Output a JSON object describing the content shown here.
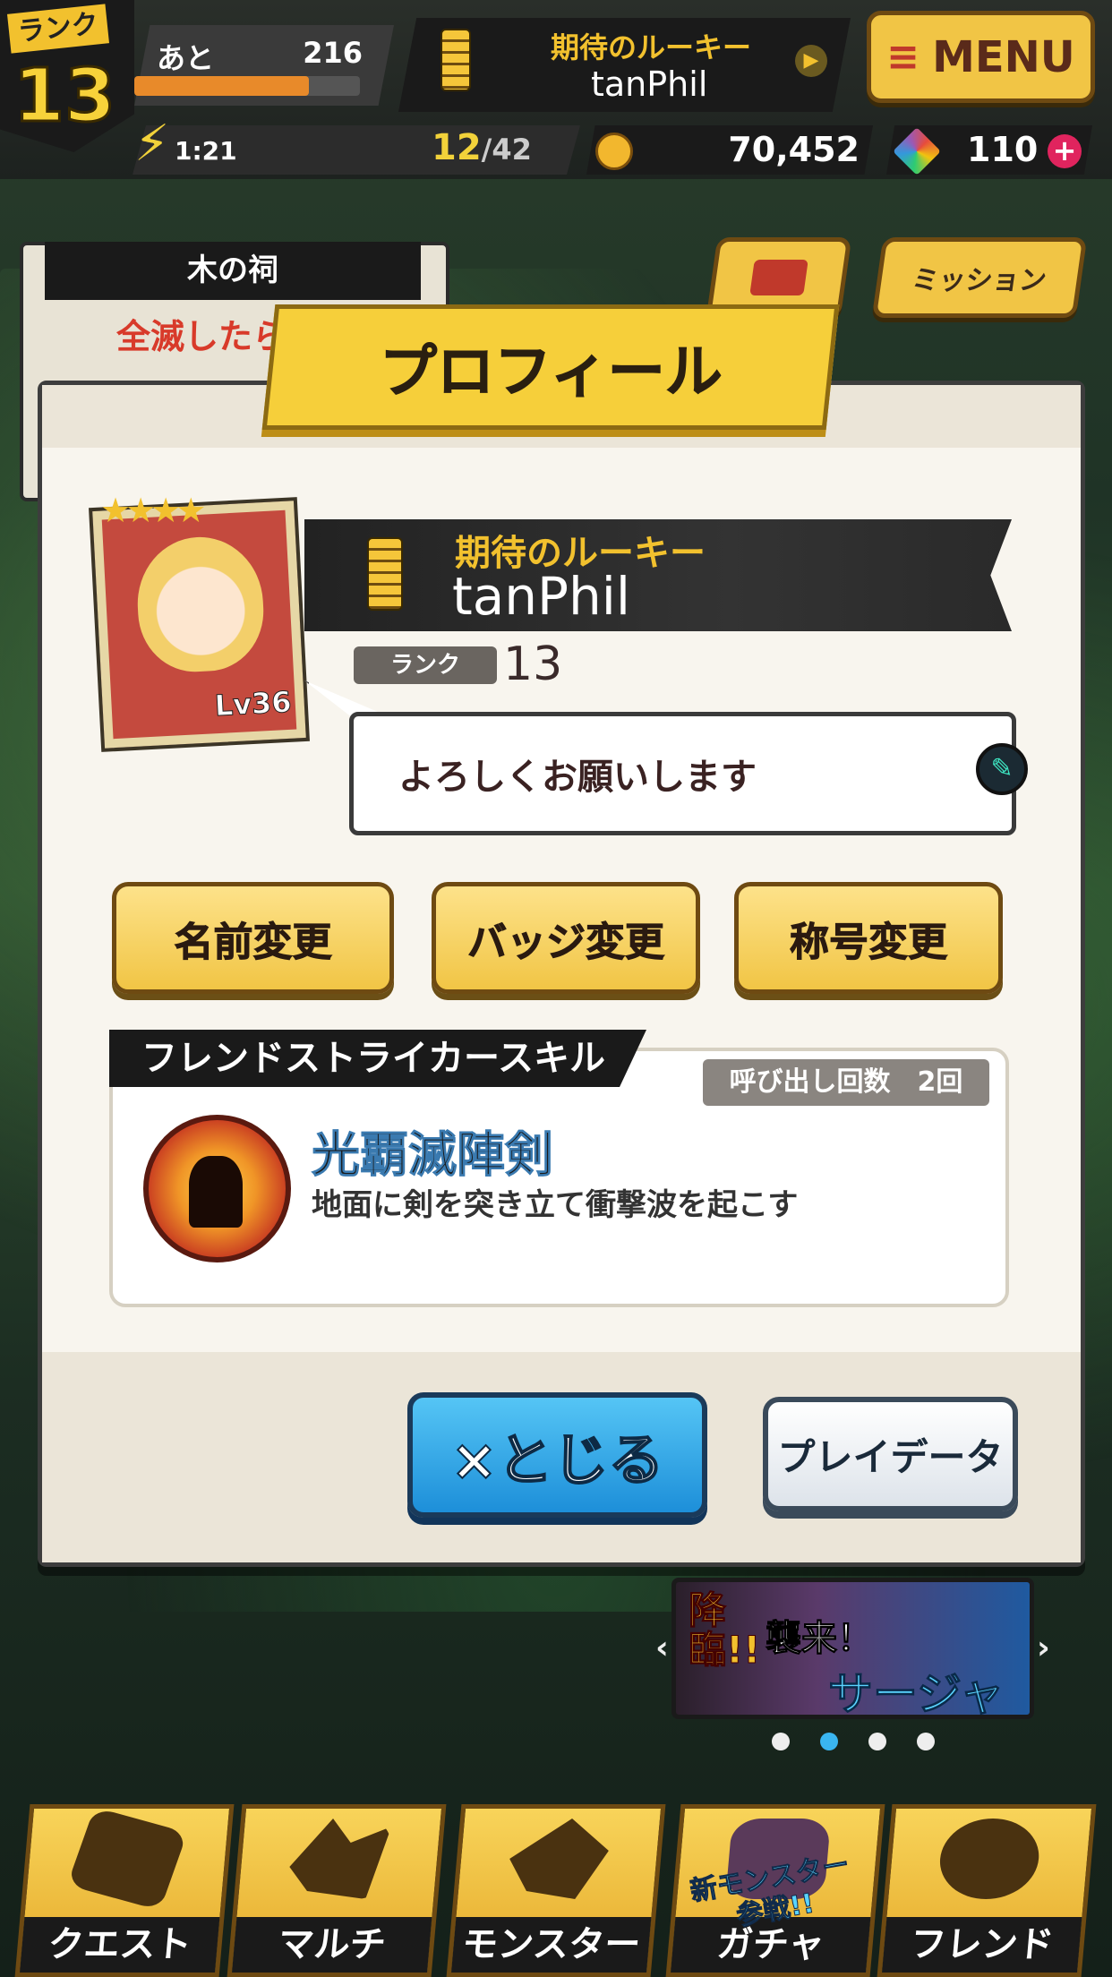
{
  "status": {
    "rank_label": "ランク",
    "rank": "13",
    "xp_label": "あと",
    "xp_remaining": "216",
    "xp_progress": 0.78,
    "title": "期待のルーキー",
    "player_name": "tanPhil",
    "menu_label": "MENU",
    "stamina_timer": "1:21",
    "stamina_current": "12",
    "stamina_max": "/42",
    "coins": "70,452",
    "gems": "110"
  },
  "background": {
    "dungeon_name": "木の祠",
    "dungeon_note": "全滅したら",
    "mission_label": "ミッション"
  },
  "modal": {
    "title": "プロフィール",
    "player_title": "期待のルーキー",
    "player_name": "tanPhil",
    "rank_label": "ランク",
    "rank_value": "13",
    "monster_level": "Lv36",
    "message": "よろしくお願いします",
    "buttons": [
      "名前変更",
      "バッジ変更",
      "称号変更"
    ],
    "skill_header": "フレンドストライカースキル",
    "call_count": "呼び出し回数　2回",
    "skill_name": "光覇滅陣剣",
    "skill_desc": "地面に剣を突き立て衝撃波を起こす",
    "close_label": "×とじる",
    "playdata_label": "プレイデータ"
  },
  "banner": {
    "label1": "降臨!!",
    "label2": "襲来！",
    "label3": "サージャ",
    "new_monster": "新モンスター参戦!!"
  },
  "nav": [
    {
      "label": "クエスト"
    },
    {
      "label": "マルチ"
    },
    {
      "label": "モンスター"
    },
    {
      "label": "ガチャ"
    },
    {
      "label": "フレンド"
    }
  ]
}
